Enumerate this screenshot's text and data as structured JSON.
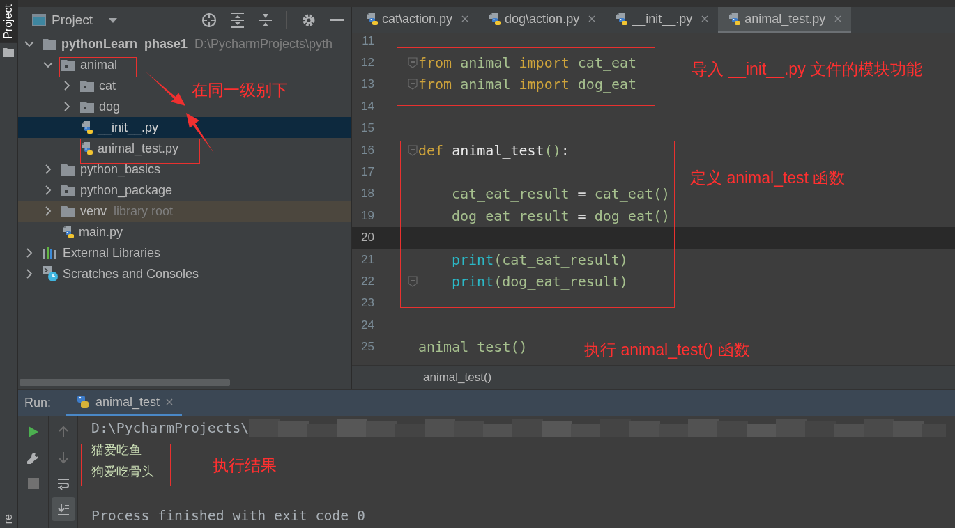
{
  "side_tabs": [
    {
      "label": "Project",
      "selected": true
    },
    {
      "label": "re",
      "selected": false
    }
  ],
  "project": {
    "title": "Project",
    "tree": [
      {
        "label": "pythonLearn_phase1",
        "hint": "D:\\PycharmProjects\\pyth",
        "kind": "project",
        "expanded": true,
        "selected": false,
        "children": [
          {
            "label": "animal",
            "kind": "package",
            "expanded": true,
            "selected": false,
            "children": [
              {
                "label": "cat",
                "kind": "package",
                "expanded": false,
                "selected": false
              },
              {
                "label": "dog",
                "kind": "package",
                "expanded": false,
                "selected": false
              },
              {
                "label": "__init__.py",
                "kind": "python",
                "selected": true
              },
              {
                "label": "animal_test.py",
                "kind": "python",
                "selected": false
              }
            ]
          },
          {
            "label": "python_basics",
            "kind": "folder",
            "expanded": false,
            "selected": false
          },
          {
            "label": "python_package",
            "kind": "package",
            "expanded": false,
            "selected": false
          },
          {
            "label": "venv",
            "hint": "library root",
            "kind": "excluded",
            "expanded": false,
            "selected": false
          },
          {
            "label": "main.py",
            "kind": "python",
            "selected": false
          }
        ]
      },
      {
        "label": "External Libraries",
        "kind": "libraries",
        "expanded": false,
        "selected": false
      },
      {
        "label": "Scratches and Consoles",
        "kind": "scratches",
        "expanded": false,
        "selected": false
      }
    ]
  },
  "editor": {
    "tabs": [
      {
        "label": "cat\\action.py",
        "selected": false
      },
      {
        "label": "dog\\action.py",
        "selected": false
      },
      {
        "label": "__init__.py",
        "selected": false
      },
      {
        "label": "animal_test.py",
        "selected": true
      }
    ],
    "lines": [
      {
        "number": "11",
        "current": false
      },
      {
        "number": "12",
        "current": false,
        "fold": true,
        "tokens": [
          {
            "kind": "kw",
            "text": "from "
          },
          {
            "kind": "name",
            "text": "animal "
          },
          {
            "kind": "kw",
            "text": "import "
          },
          {
            "kind": "name",
            "text": "cat_eat"
          }
        ]
      },
      {
        "number": "13",
        "current": false,
        "fold": true,
        "tokens": [
          {
            "kind": "kw",
            "text": "from "
          },
          {
            "kind": "name",
            "text": "animal "
          },
          {
            "kind": "kw",
            "text": "import "
          },
          {
            "kind": "name",
            "text": "dog_eat"
          }
        ]
      },
      {
        "number": "14",
        "current": false
      },
      {
        "number": "15",
        "current": false
      },
      {
        "number": "16",
        "current": false,
        "fold": true,
        "tokens": [
          {
            "kind": "kw",
            "text": "def "
          },
          {
            "kind": "def",
            "text": "animal_test"
          },
          {
            "kind": "name",
            "text": "()"
          },
          {
            "kind": "pl",
            "text": ":"
          }
        ]
      },
      {
        "number": "17",
        "current": false
      },
      {
        "number": "18",
        "current": false,
        "nested": true,
        "tokens": [
          {
            "kind": "name",
            "text": "cat_eat_result"
          },
          {
            "kind": "pl",
            "text": " = "
          },
          {
            "kind": "name",
            "text": "cat_eat()"
          }
        ]
      },
      {
        "number": "19",
        "current": false,
        "nested": true,
        "tokens": [
          {
            "kind": "name",
            "text": "dog_eat_result"
          },
          {
            "kind": "pl",
            "text": " = "
          },
          {
            "kind": "name",
            "text": "dog_eat()"
          }
        ]
      },
      {
        "number": "20",
        "current": true
      },
      {
        "number": "21",
        "current": false,
        "nested": true,
        "tokens": [
          {
            "kind": "fn",
            "text": "print"
          },
          {
            "kind": "name",
            "text": "(cat_eat_result)"
          }
        ]
      },
      {
        "number": "22",
        "current": false,
        "nested": true,
        "fold": true,
        "tokens": [
          {
            "kind": "fn",
            "text": "print"
          },
          {
            "kind": "name",
            "text": "(dog_eat_result)"
          }
        ]
      },
      {
        "number": "23",
        "current": false
      },
      {
        "number": "24",
        "current": false
      },
      {
        "number": "25",
        "current": false,
        "tokens": [
          {
            "kind": "name",
            "text": "animal_test()"
          }
        ]
      }
    ],
    "breadcrumb": "animal_test()"
  },
  "run": {
    "label": "Run:",
    "tabs": [
      {
        "label": "animal_test",
        "selected": true
      }
    ],
    "tools_left": [
      {
        "kind": "run",
        "disabled": false
      },
      {
        "kind": "settings",
        "disabled": false
      },
      {
        "kind": "stop",
        "disabled": true
      }
    ],
    "tools_right": [
      {
        "kind": "up",
        "disabled": true,
        "on": false
      },
      {
        "kind": "down",
        "disabled": true,
        "on": false
      },
      {
        "kind": "wrap",
        "disabled": false,
        "on": false
      },
      {
        "kind": "scroll",
        "disabled": false,
        "on": true
      }
    ],
    "console": [
      {
        "kind": "path",
        "text": "D:\\PycharmProjects\\"
      },
      {
        "kind": "output",
        "text": "猫爱吃鱼"
      },
      {
        "kind": "output",
        "text": "狗爱吃骨头"
      },
      {
        "kind": "blank"
      },
      {
        "kind": "status",
        "text": "Process finished with exit code 0"
      }
    ]
  },
  "notes": [
    "在同一级别下",
    "导入 __init__.py 文件的模块功能",
    "定义 animal_test 函数",
    "执行 animal_test() 函数",
    "执行结果"
  ]
}
